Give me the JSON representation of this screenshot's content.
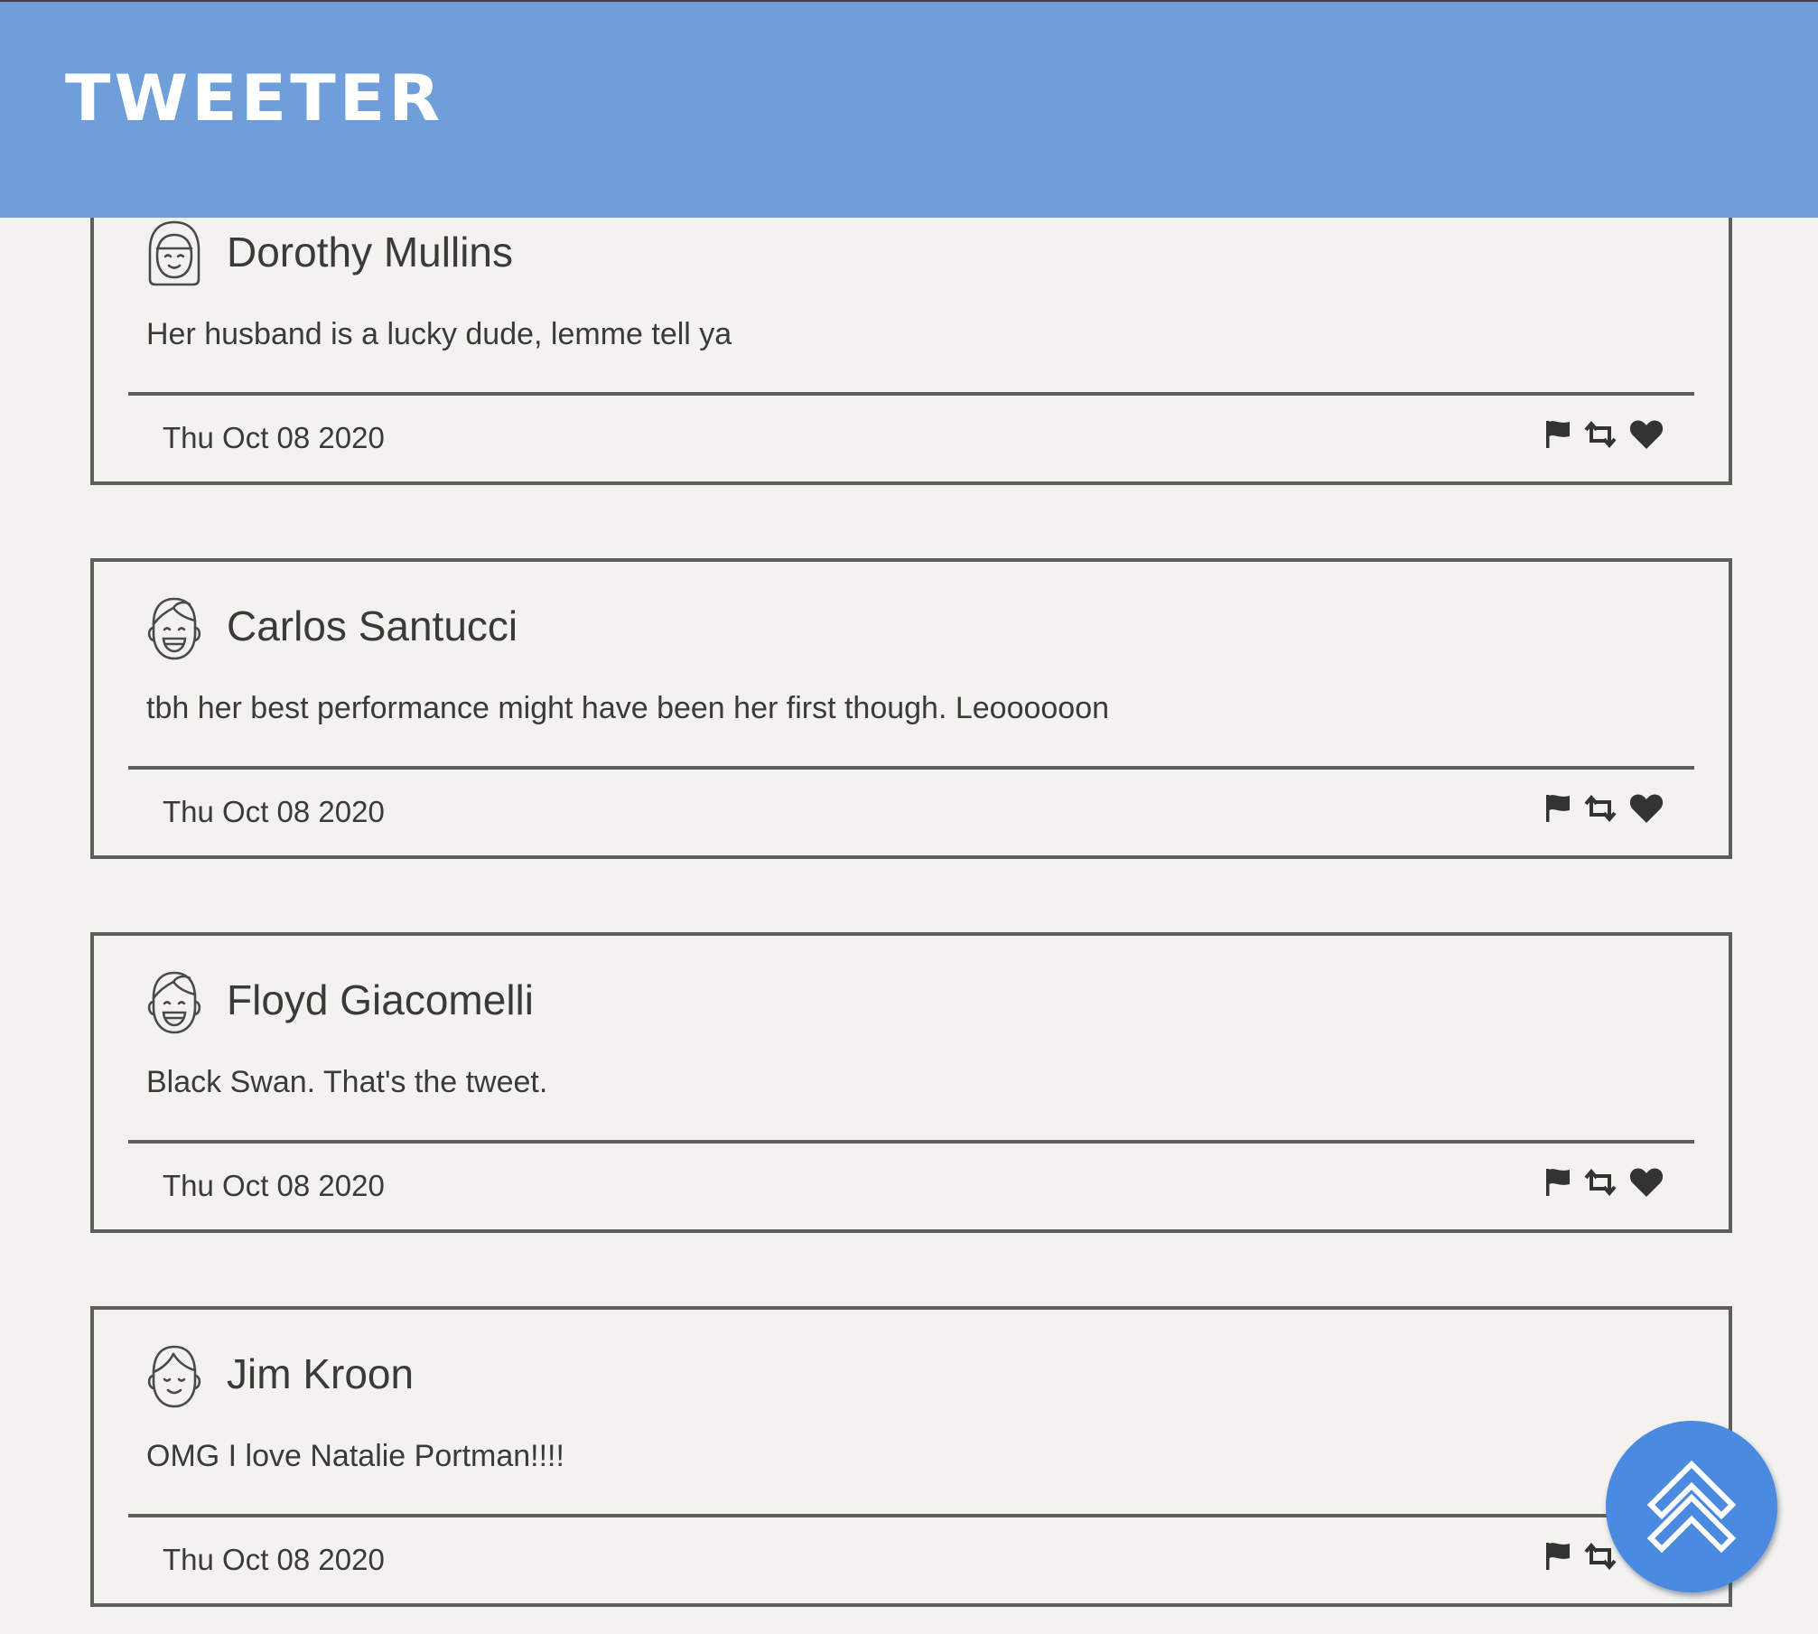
{
  "header": {
    "brand": "TWEETER",
    "background_color": "#6f9fdb"
  },
  "tweets": [
    {
      "author": "Dorothy Mullins",
      "avatar_icon": "girl-face-icon",
      "text": "Her husband is a lucky dude, lemme tell ya",
      "date": "Thu Oct 08 2020"
    },
    {
      "author": "Carlos Santucci",
      "avatar_icon": "boy-laughing-face-icon",
      "text": "tbh her best performance might have been her first though. Leoooooon",
      "date": "Thu Oct 08 2020"
    },
    {
      "author": "Floyd Giacomelli",
      "avatar_icon": "boy-laughing-face-icon",
      "text": "Black Swan. That's the tweet.",
      "date": "Thu Oct 08 2020"
    },
    {
      "author": "Jim Kroon",
      "avatar_icon": "smiling-face-icon",
      "text": "OMG I love Natalie Portman!!!!",
      "date": "Thu Oct 08 2020"
    }
  ],
  "tweet_actions": [
    "flag-icon",
    "retweet-icon",
    "heart-icon"
  ],
  "scroll_top_button": {
    "icon": "double-chevron-up-icon",
    "color": "#4a8ae1"
  }
}
